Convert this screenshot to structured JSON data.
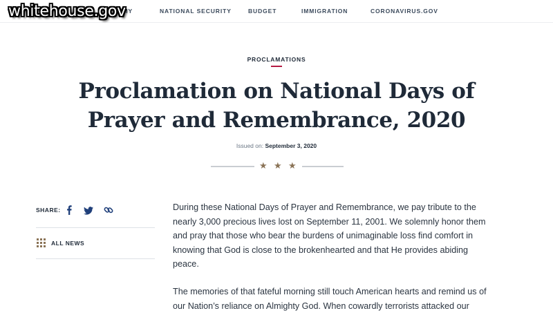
{
  "watermark": "whitehouse.gov",
  "nav": {
    "items": [
      "ECONOMY",
      "NATIONAL SECURITY",
      "BUDGET",
      "IMMIGRATION",
      "CORONAVIRUS.GOV"
    ],
    "partial_first": "OMY"
  },
  "article": {
    "category": "PROCLAMATIONS",
    "title_lines": [
      "Proclamation on National Days of",
      "Prayer and Remembrance, 2020"
    ],
    "issued_label": "Issued on:",
    "issued_date": "September 3, 2020",
    "paragraphs": [
      [
        "During these National Days of Prayer and Remembrance, we pay tribute to the",
        "nearly 3,000 precious lives lost on September 11, 2001.  We solemnly honor them",
        "and pray that those who bear the burdens of unimaginable loss find comfort in",
        "knowing that God is close to the brokenhearted and that He provides abiding",
        "peace."
      ],
      [
        "The memories of that fateful morning still touch American hearts and remind us of",
        "our Nation’s reliance on Almighty God.  When cowardly terrorists attacked our"
      ]
    ]
  },
  "sidebar": {
    "share_label": "SHARE:",
    "share_icons": [
      "facebook-icon",
      "twitter-icon",
      "link-icon"
    ],
    "all_news_label": "ALL NEWS",
    "all_news_icon": "grid-icon"
  },
  "colors": {
    "text_dark": "#1f2a38",
    "accent_red": "#b31942",
    "star_gold": "#8a7356",
    "share_blue": "#1f3f7a"
  }
}
